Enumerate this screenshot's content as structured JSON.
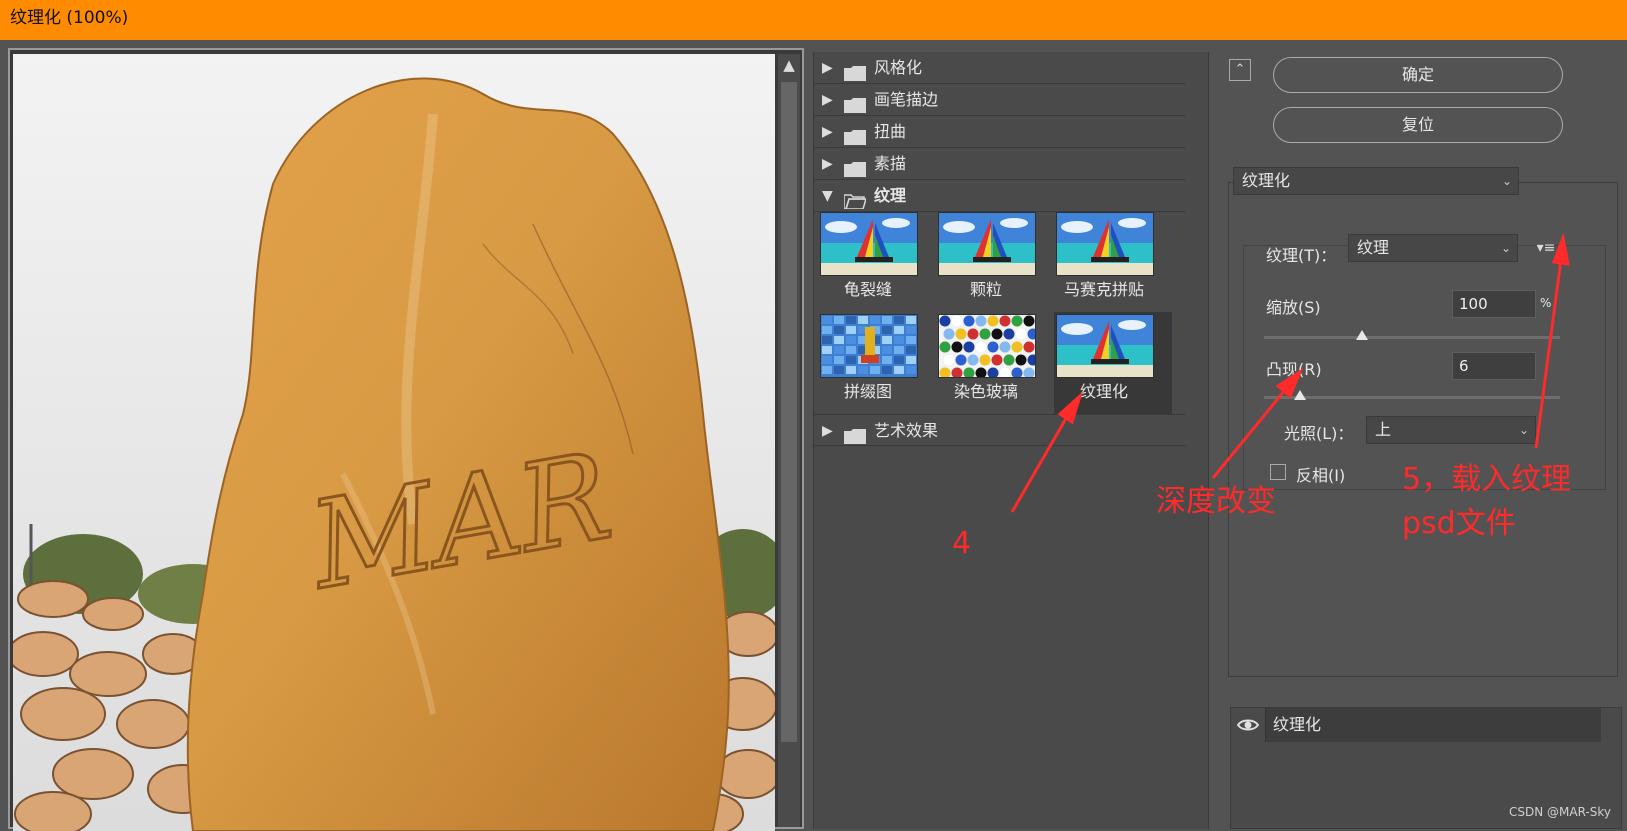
{
  "window": {
    "title": "纹理化 (100%)"
  },
  "preview": {
    "carved_text": "MAR"
  },
  "gallery": {
    "folders_top": [
      {
        "label": "风格化",
        "expanded": false
      },
      {
        "label": "画笔描边",
        "expanded": false
      },
      {
        "label": "扭曲",
        "expanded": false
      },
      {
        "label": "素描",
        "expanded": false
      },
      {
        "label": "纹理",
        "expanded": true
      }
    ],
    "thumbnails": [
      {
        "label": "龟裂缝",
        "selected": false
      },
      {
        "label": "颗粒",
        "selected": false
      },
      {
        "label": "马赛克拼贴",
        "selected": false
      },
      {
        "label": "拼缀图",
        "selected": false
      },
      {
        "label": "染色玻璃",
        "selected": false
      },
      {
        "label": "纹理化",
        "selected": true
      }
    ],
    "folder_bottom": {
      "label": "艺术效果",
      "expanded": false
    }
  },
  "buttons": {
    "ok": "确定",
    "reset": "复位"
  },
  "filter_select": {
    "value": "纹理化"
  },
  "texture": {
    "label": "纹理(T)：",
    "value": "纹理",
    "scale_label": "缩放(S)",
    "scale_value": "100",
    "scale_unit": "%",
    "scale_level": 0.33,
    "relief_label": "凸现(R)",
    "relief_value": "6",
    "relief_level": 0.12,
    "light_label": "光照(L)：",
    "light_value": "上",
    "invert_label": "反相(I)",
    "invert_checked": false
  },
  "layers": [
    {
      "label": "纹理化",
      "visible": true
    }
  ],
  "annotations": {
    "step4": "4",
    "depth": "深度改变",
    "step5_line1": "5，载入纹理",
    "step5_line2": "psd文件",
    "color": "#ff2a2a"
  },
  "watermark": "CSDN @MAR-Sky",
  "colors": {
    "titlebar": "#ff8c00",
    "panel": "#535353",
    "annotation": "#ff2a2a"
  }
}
